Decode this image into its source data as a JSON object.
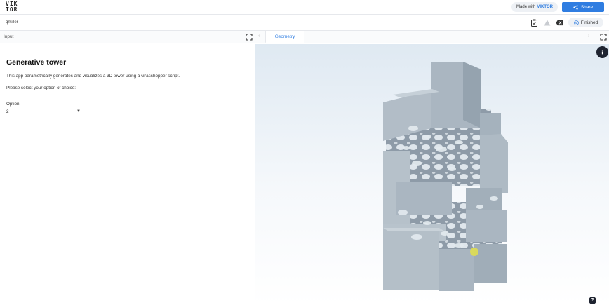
{
  "topbar": {
    "logo_line1": "VIK",
    "logo_line2": "TOR",
    "made_with_prefix": "Made with",
    "made_with_brand": "VIKTOR",
    "share_label": "Share",
    "share_icon": "share-icon"
  },
  "appbar": {
    "app_name": "qrkiller",
    "tools": [
      "clipboard-icon",
      "warning-icon",
      "backspace-icon"
    ],
    "status_label": "Finished",
    "status_icon": "check-circle-icon"
  },
  "left_panel": {
    "header_title": "Input",
    "heading": "Generative tower",
    "description": "This app parametrically generates and visualizes a 3D tower using a Grasshopper script.",
    "prompt": "Please select your option of choice:",
    "option_label": "Option",
    "option_value": "2"
  },
  "right_panel": {
    "tab_label": "Geometry",
    "menu_icon": "more-vertical-icon",
    "help_icon": "help-icon"
  },
  "colors": {
    "accent": "#2f7de1",
    "fab": "#1e2330",
    "tower": "#a9b6c2"
  }
}
